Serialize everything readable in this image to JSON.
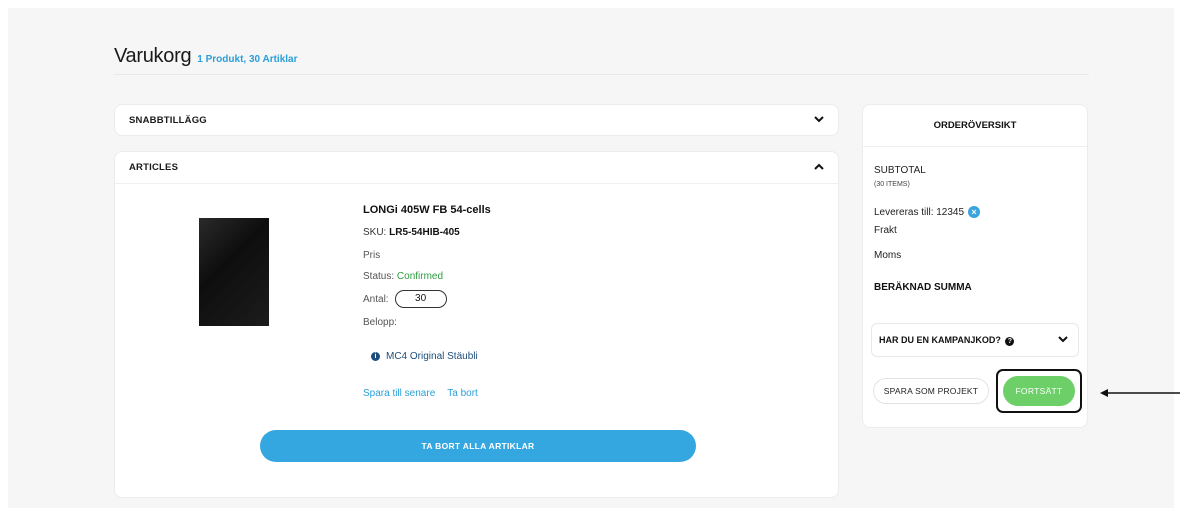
{
  "header": {
    "title": "Varukorg",
    "count": "1 Produkt, 30 Artiklar"
  },
  "snabbtillagg": {
    "label": "SNABBTILLÄGG"
  },
  "articles": {
    "label": "ARTICLES",
    "product": {
      "name": "LONGi 405W FB 54-cells",
      "sku_label": "SKU:",
      "sku": "LR5-54HIB-405",
      "price_label": "Pris",
      "status_label": "Status:",
      "status_value": "Confirmed",
      "quantity_label": "Antal:",
      "quantity": "30",
      "amount_label": "Belopp:",
      "addon": "MC4 Original Stäubli",
      "save_later": "Spara till senare",
      "remove": "Ta bort"
    },
    "remove_all": "TA BORT ALLA ARTIKLAR"
  },
  "summary": {
    "title": "ORDERÖVERSIKT",
    "subtotal": "SUBTOTAL",
    "items": "(30 ITEMS)",
    "deliver_to": "Levereras till: 12345",
    "shipping": "Frakt",
    "vat": "Moms",
    "estimated_total": "BERÄKNAD SUMMA",
    "campaign": "HAR DU EN KAMPANJKOD?",
    "save_project": "SPARA SOM PROJEKT",
    "continue": "FORTSÄTT"
  },
  "colors": {
    "accent_blue": "#35a7e0",
    "continue_green": "#6ccf67",
    "status_green": "#2e9b3e"
  }
}
